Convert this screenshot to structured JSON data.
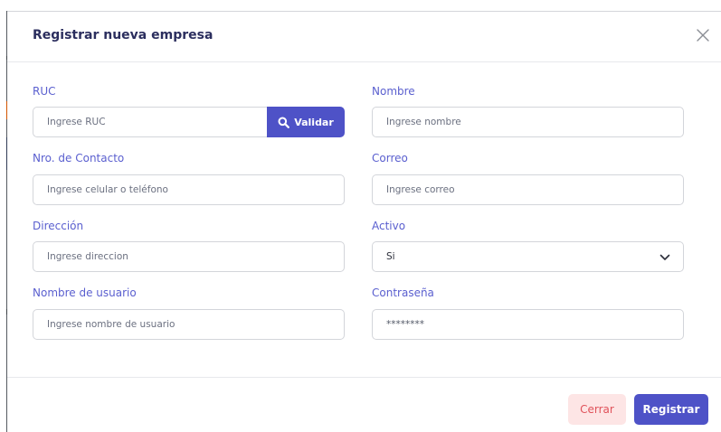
{
  "modal": {
    "title": "Registrar nueva empresa",
    "close_icon": "close-icon"
  },
  "form": {
    "ruc": {
      "label": "RUC",
      "placeholder": "Ingrese RUC"
    },
    "validar": {
      "label": "Validar",
      "icon": "search-icon"
    },
    "nombre": {
      "label": "Nombre",
      "placeholder": "Ingrese nombre"
    },
    "contacto": {
      "label": "Nro. de Contacto",
      "placeholder": "Ingrese celular o teléfono"
    },
    "correo": {
      "label": "Correo",
      "placeholder": "Ingrese correo"
    },
    "direccion": {
      "label": "Dirección",
      "placeholder": "Ingrese direccion"
    },
    "activo": {
      "label": "Activo",
      "value": "Si",
      "icon": "chevron-down-icon"
    },
    "usuario": {
      "label": "Nombre de usuario",
      "placeholder": "Ingrese nombre de usuario"
    },
    "contrasena": {
      "label": "Contraseña",
      "value": "********"
    }
  },
  "footer": {
    "cerrar_label": "Cerrar",
    "registrar_label": "Registrar"
  },
  "colors": {
    "accent": "#4e52c7",
    "label": "#5a5fcf",
    "title": "#2b2e5e",
    "danger_bg": "#fde5e5",
    "danger_text": "#e0525a"
  }
}
